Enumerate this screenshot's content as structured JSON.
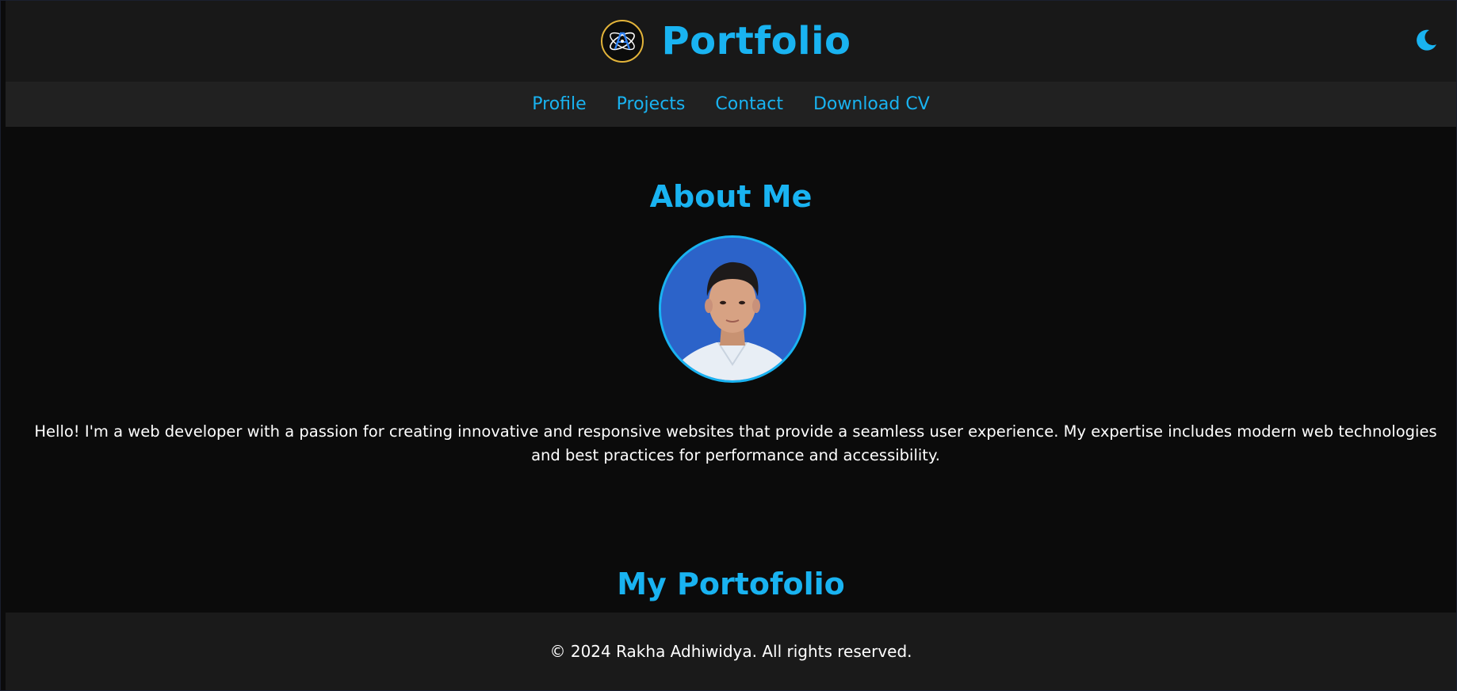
{
  "header": {
    "title": "Portfolio",
    "logo_icon": "logo-icon",
    "theme_toggle_icon": "moon-icon"
  },
  "nav": {
    "items": [
      {
        "label": "Profile"
      },
      {
        "label": "Projects"
      },
      {
        "label": "Contact"
      },
      {
        "label": "Download CV"
      }
    ]
  },
  "about": {
    "title": "About Me",
    "text": "Hello! I'm a web developer with a passion for creating innovative and responsive websites that provide a seamless user experience. My expertise includes modern web technologies and best practices for performance and accessibility."
  },
  "portfolio": {
    "title": "My Portofolio"
  },
  "footer": {
    "text": "© 2024 Rakha Adhiwidya. All rights reserved."
  },
  "colors": {
    "accent": "#19b3f1",
    "background": "#0b0b0b",
    "header_bg": "#181818",
    "nav_bg": "#212121",
    "footer_bg": "#1a1a1a",
    "logo_ring": "#e3b43a"
  }
}
